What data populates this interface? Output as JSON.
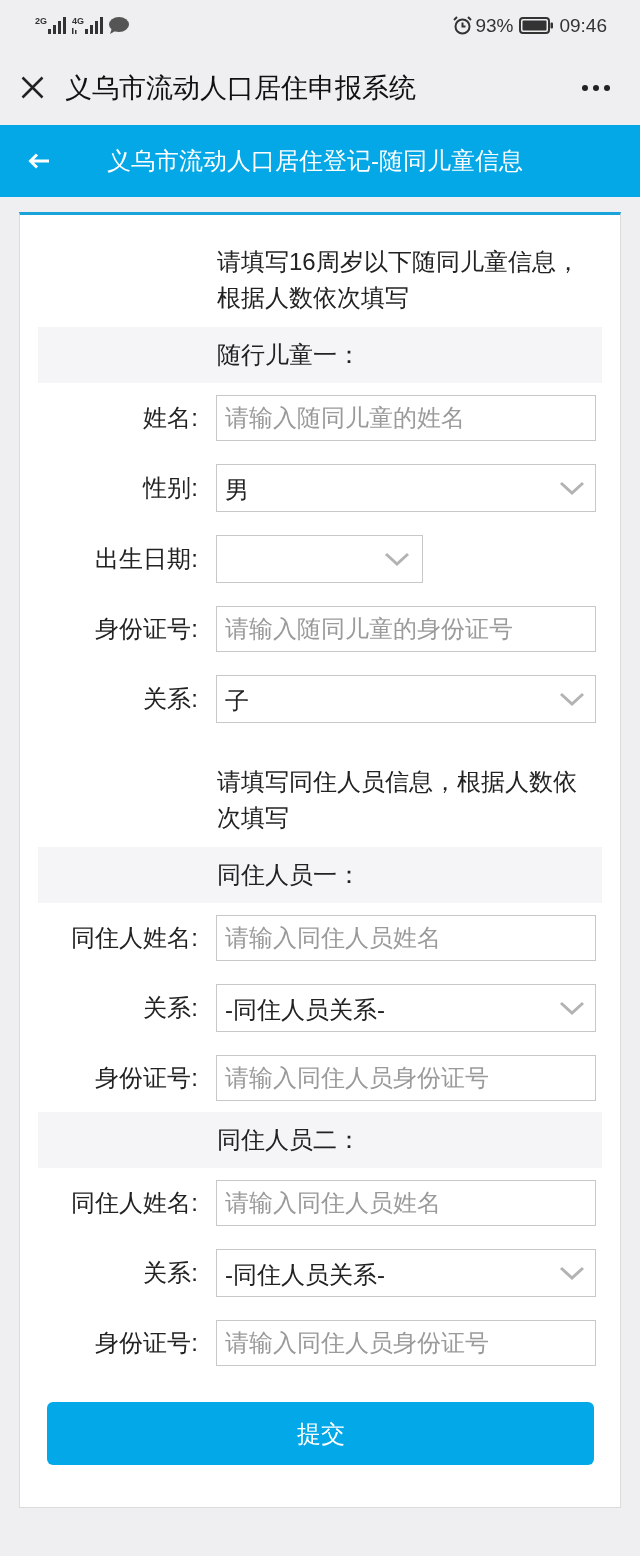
{
  "status_bar": {
    "network_1": "2G",
    "network_2": "4G",
    "battery": "93%",
    "time": "09:46"
  },
  "title_bar": {
    "title": "义乌市流动人口居住申报系统"
  },
  "header": {
    "title": "义乌市流动人口居住登记-随同儿童信息"
  },
  "form": {
    "items": [
      {
        "kind": "note",
        "text": "请填写16周岁以下随同儿童信息，根据人数依次填写"
      },
      {
        "kind": "section",
        "title": "随行儿童一："
      },
      {
        "kind": "input",
        "label": "姓名:",
        "placeholder": "请输入随同儿童的姓名"
      },
      {
        "kind": "select",
        "label": "性别:",
        "value": "男"
      },
      {
        "kind": "date",
        "label": "出生日期:"
      },
      {
        "kind": "input",
        "label": "身份证号:",
        "placeholder": "请输入随同儿童的身份证号"
      },
      {
        "kind": "select",
        "label": "关系:",
        "value": "子"
      },
      {
        "kind": "note",
        "text": "请填写同住人员信息，根据人数依次填写"
      },
      {
        "kind": "section",
        "title": "同住人员一："
      },
      {
        "kind": "input",
        "label": "同住人姓名:",
        "placeholder": "请输入同住人员姓名"
      },
      {
        "kind": "select",
        "label": "关系:",
        "value": "-同住人员关系-"
      },
      {
        "kind": "input",
        "label": "身份证号:",
        "placeholder": "请输入同住人员身份证号"
      },
      {
        "kind": "section",
        "title": "同住人员二："
      },
      {
        "kind": "input",
        "label": "同住人姓名:",
        "placeholder": "请输入同住人员姓名"
      },
      {
        "kind": "select",
        "label": "关系:",
        "value": "-同住人员关系-"
      },
      {
        "kind": "input",
        "label": "身份证号:",
        "placeholder": "请输入同住人员身份证号"
      }
    ]
  },
  "submit_button": {
    "label": "提交"
  }
}
